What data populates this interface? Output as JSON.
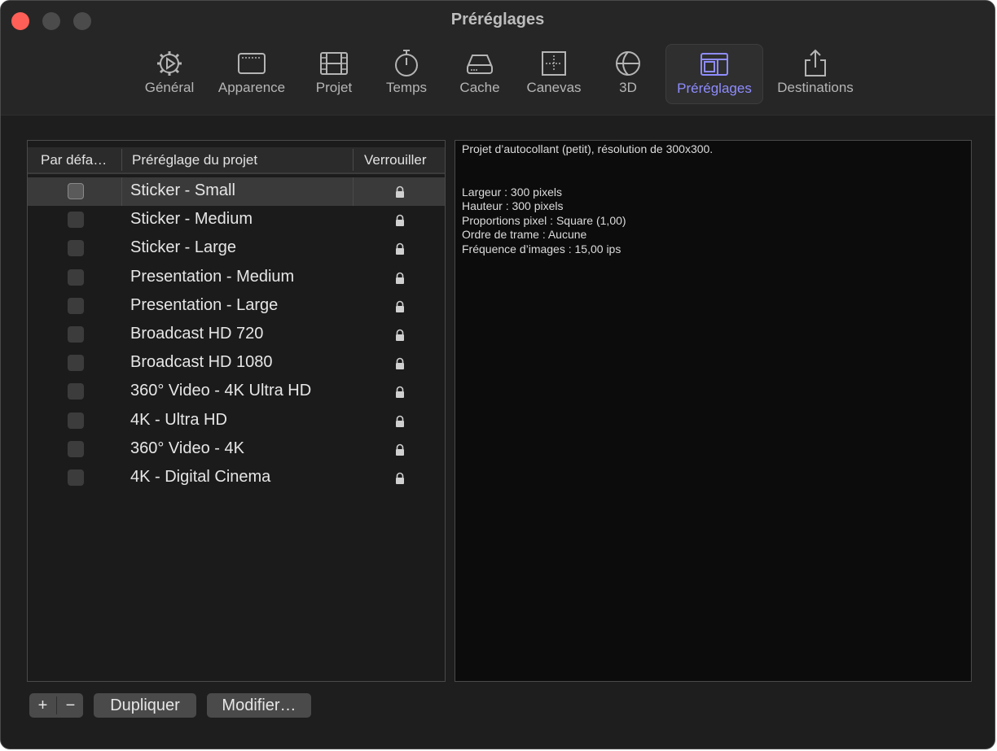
{
  "window": {
    "title": "Préréglages"
  },
  "toolbar": {
    "items": [
      {
        "label": "Général",
        "icon": "gear-play-icon"
      },
      {
        "label": "Apparence",
        "icon": "window-icon"
      },
      {
        "label": "Projet",
        "icon": "film-icon"
      },
      {
        "label": "Temps",
        "icon": "stopwatch-icon"
      },
      {
        "label": "Cache",
        "icon": "drive-icon"
      },
      {
        "label": "Canevas",
        "icon": "canvas-icon"
      },
      {
        "label": "3D",
        "icon": "globe-icon"
      },
      {
        "label": "Préréglages",
        "icon": "presets-icon",
        "active": true
      },
      {
        "label": "Destinations",
        "icon": "share-icon"
      }
    ],
    "accent_color": "#8f8cff"
  },
  "table": {
    "columns": [
      "Par défa…",
      "Préréglage du projet",
      "Verrouiller"
    ],
    "rows": [
      {
        "name": "Sticker - Small",
        "selected": true
      },
      {
        "name": "Sticker - Medium"
      },
      {
        "name": "Sticker - Large"
      },
      {
        "name": "Presentation - Medium"
      },
      {
        "name": "Presentation - Large"
      },
      {
        "name": "Broadcast HD 720"
      },
      {
        "name": "Broadcast HD 1080"
      },
      {
        "name": "360° Video - 4K Ultra HD"
      },
      {
        "name": "4K - Ultra HD"
      },
      {
        "name": "360° Video - 4K"
      },
      {
        "name": "4K - Digital Cinema"
      }
    ]
  },
  "details": {
    "description": "Projet d’autocollant (petit), résolution de 300x300.",
    "lines": [
      "Largeur : 300 pixels",
      "Hauteur : 300 pixels",
      "Proportions pixel : Square (1,00)",
      "Ordre de trame : Aucune",
      "Fréquence d’images : 15,00 ips"
    ]
  },
  "buttons": {
    "add": "+",
    "remove": "−",
    "duplicate": "Dupliquer",
    "modify": "Modifier…"
  }
}
